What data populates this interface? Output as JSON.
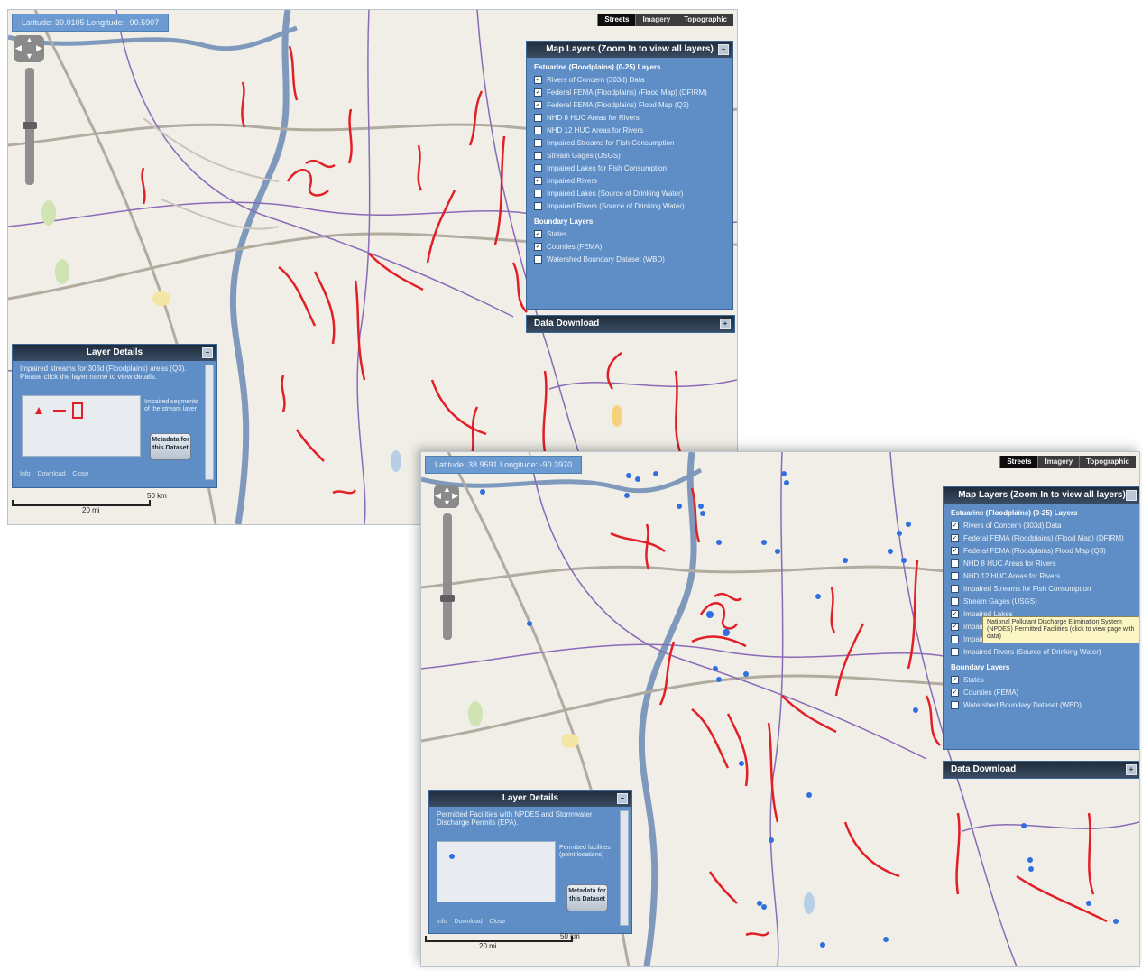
{
  "screen1": {
    "coords": "Latitude: 39.0105 Longitude: -90.5907",
    "basemap": [
      "Streets",
      "Imagery",
      "Topographic"
    ],
    "layers_panel": {
      "title": "Map Layers (Zoom In to view all layers)",
      "section1": "Estuarine (Floodplains) (0-25) Layers",
      "layers": [
        {
          "label": "Rivers of Concern (303d) Data",
          "checked": true
        },
        {
          "label": "Federal FEMA (Floodplains) (Flood Map) (DFIRM)",
          "checked": true
        },
        {
          "label": "Federal FEMA (Floodplains) Flood Map (Q3)",
          "checked": true
        },
        {
          "label": "NHD 8 HUC Areas for Rivers",
          "checked": false
        },
        {
          "label": "NHD 12 HUC Areas for Rivers",
          "checked": false
        },
        {
          "label": "Impaired Streams for Fish Consumption",
          "checked": false
        },
        {
          "label": "Stream Gages (USGS)",
          "checked": false
        },
        {
          "label": "Impaired Lakes for Fish Consumption",
          "checked": false
        },
        {
          "label": "Impaired Rivers",
          "checked": true
        },
        {
          "label": "Impaired Lakes (Source of Drinking Water)",
          "checked": false
        },
        {
          "label": "Impaired Rivers (Source of Drinking Water)",
          "checked": false
        }
      ],
      "section2": "Boundary Layers",
      "boundary_layers": [
        {
          "label": "States",
          "checked": true
        },
        {
          "label": "Counties (FEMA)",
          "checked": true
        },
        {
          "label": "Watershed Boundary Dataset (WBD)",
          "checked": false
        }
      ]
    },
    "download_title": "Data Download",
    "details_panel": {
      "title": "Layer Details",
      "description": "Impaired streams for 303d (Floodplains) areas (Q3). Please click the layer name to view details.",
      "legend_note": "Impaired segments of the stream layer",
      "metadata_button": "Metadata for this Dataset",
      "links": [
        "Info",
        "Download",
        "Close"
      ]
    },
    "scale": {
      "km": "50 km",
      "mi": "20 mi"
    }
  },
  "screen2": {
    "coords": "Latitude: 38.9591 Longitude: -90.3970",
    "basemap": [
      "Streets",
      "Imagery",
      "Topographic"
    ],
    "layers_panel": {
      "title": "Map Layers (Zoom In to view all layers)",
      "section1": "Estuarine (Floodplains) (0-25) Layers",
      "layers": [
        {
          "label": "Rivers of Concern (303d) Data",
          "checked": true
        },
        {
          "label": "Federal FEMA (Floodplains) (Flood Map) (DFIRM)",
          "checked": true
        },
        {
          "label": "Federal FEMA (Floodplains) Flood Map (Q3)",
          "checked": true
        },
        {
          "label": "NHD 8 HUC Areas for Rivers",
          "checked": false
        },
        {
          "label": "NHD 12 HUC Areas for Rivers",
          "checked": false
        },
        {
          "label": "Impaired Streams for Fish Consumption",
          "checked": false
        },
        {
          "label": "Stream Gages (USGS)",
          "checked": false
        },
        {
          "label": "Impaired Lakes",
          "checked": true
        },
        {
          "label": "Impaired Rivers",
          "checked": true
        },
        {
          "label": "Impaired Lakes (Source of Drinking Water)",
          "checked": false
        },
        {
          "label": "Impaired Rivers (Source of Drinking Water)",
          "checked": false
        }
      ],
      "section2": "Boundary Layers",
      "boundary_layers": [
        {
          "label": "States",
          "checked": true
        },
        {
          "label": "Counties (FEMA)",
          "checked": true
        },
        {
          "label": "Watershed Boundary Dataset (WBD)",
          "checked": false
        }
      ]
    },
    "tooltip": "National Pollutant Discharge Elimination System (NPDES) Permitted Facilities (click to view page with data)",
    "download_title": "Data Download",
    "details_panel": {
      "title": "Layer Details",
      "description": "Permitted Facilities with NPDES and Stormwater Discharge Permits (EPA).",
      "legend_note": "Permitted facilities (point locations)",
      "metadata_button": "Metadata for this Dataset",
      "links": [
        "Info",
        "Download",
        "Close"
      ]
    },
    "scale": {
      "km": "50 km",
      "mi": "20 mi"
    }
  },
  "colors": {
    "map_bg": "#f0eee7",
    "panel": "#5e8ec5",
    "impaired_river": "#e21f26",
    "facility_point": "#2f6fe0",
    "boundary": "#8a6bb8"
  }
}
